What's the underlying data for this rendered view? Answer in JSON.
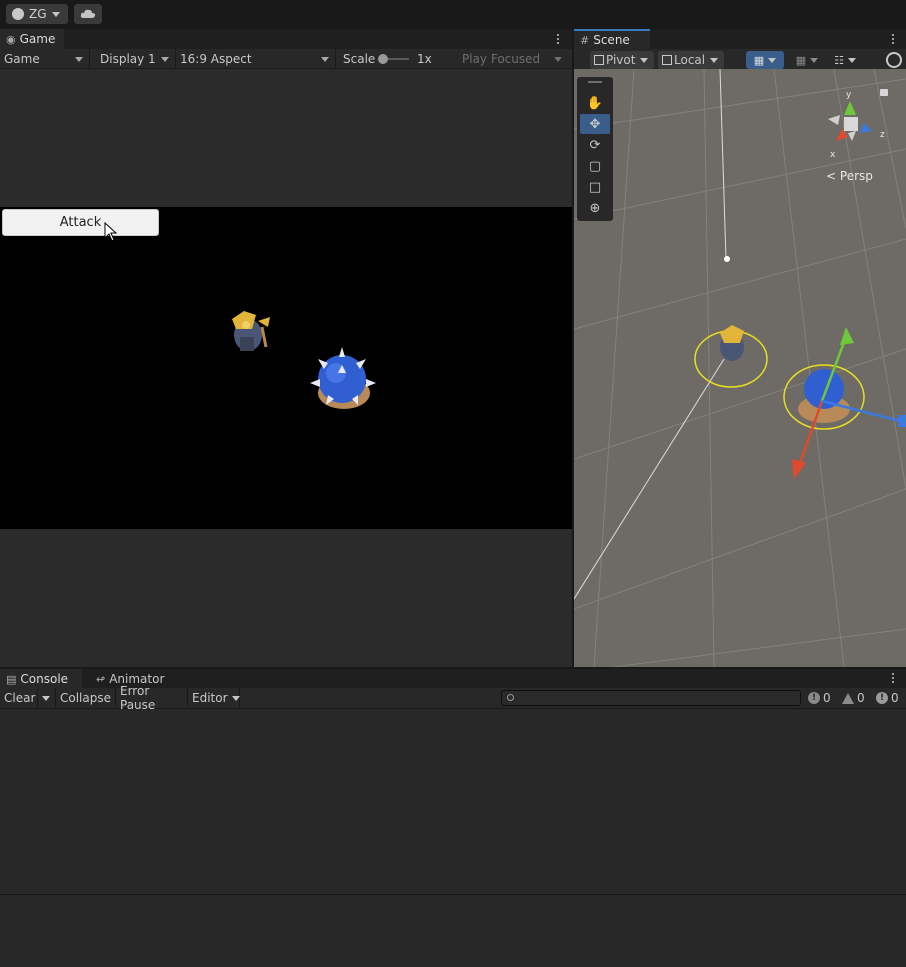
{
  "topbar": {
    "account_label": "ZG"
  },
  "game_panel": {
    "tab_label": "Game",
    "toolbar": {
      "view_mode": "Game",
      "display": "Display 1",
      "aspect": "16:9 Aspect",
      "scale_label": "Scale",
      "scale_value": "1x",
      "play_mode": "Play Focused"
    },
    "attack_button_label": "Attack"
  },
  "scene_panel": {
    "tab_label": "Scene",
    "pivot_label": "Pivot",
    "local_label": "Local",
    "projection_label": "Persp",
    "tools": [
      "hand",
      "move",
      "rotate",
      "scale",
      "rect",
      "transform"
    ]
  },
  "bottom_panel": {
    "tabs": [
      {
        "label": "Console"
      },
      {
        "label": "Animator"
      }
    ],
    "toolbar": {
      "clear_label": "Clear",
      "collapse_label": "Collapse",
      "error_pause_label": "Error Pause",
      "editor_label": "Editor"
    },
    "counts": {
      "info": "0",
      "warnings": "0",
      "errors": "0"
    }
  },
  "colors": {
    "selection_blue": "#3a5e8c",
    "scene_bg": "#6e6b66"
  }
}
